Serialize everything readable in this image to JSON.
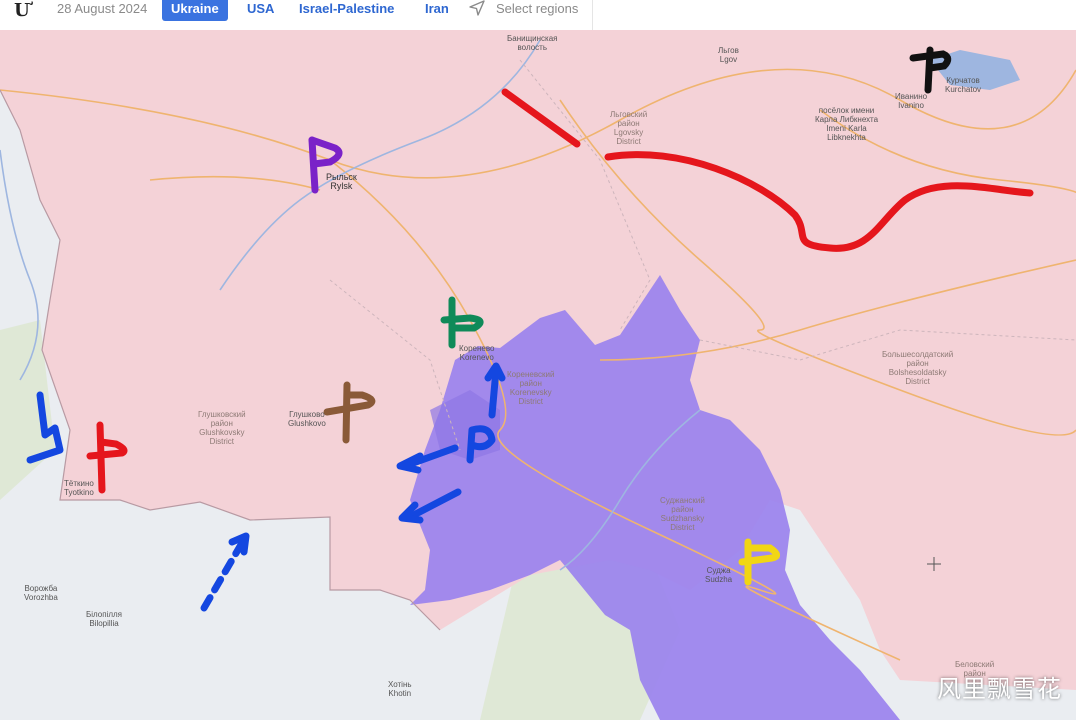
{
  "toolbar": {
    "logo": "Ư",
    "date": "28 August 2024",
    "tabs": [
      {
        "label": "Ukraine",
        "active": true
      },
      {
        "label": "USA",
        "active": false
      },
      {
        "label": "Israel-Palestine",
        "active": false
      },
      {
        "label": "Iran",
        "active": false
      }
    ],
    "select_regions": "Select regions",
    "select_icon": "navigation-arrow-icon"
  },
  "map": {
    "colors": {
      "russia_territory": "#f4d2d7",
      "occupied_zone": "#9a82ee",
      "ukraine_territory": "#eaedf1",
      "roads": "#efb46f",
      "annotation_red": "#e5161c",
      "annotation_blue": "#1447e0"
    },
    "labels": {
      "bachinskaya": [
        "Банищинская",
        "волость"
      ],
      "lgov": [
        "Льгов",
        "Lgov"
      ],
      "kurchatov": [
        "Курчатов",
        "Kurchatov"
      ],
      "ivanino": [
        "Иванино",
        "Ivanino"
      ],
      "imeni_karla": [
        "посёлок имени",
        "Карла Либкнехта",
        "Imeni Karla",
        "Libknekhta"
      ],
      "lgovsky_district": [
        "Льговский",
        "район",
        "Lgovsky",
        "District"
      ],
      "rylsk": [
        "Рыльск",
        "Rylsk"
      ],
      "korenevo": [
        "Коренево",
        "Korenevo"
      ],
      "korenevsky_district": [
        "Кореневский",
        "район",
        "Korenevsky",
        "District"
      ],
      "glushkovsky_district": [
        "Глушковский",
        "район",
        "Glushkovsky",
        "District"
      ],
      "glushkovo": [
        "Глушково",
        "Glushkovo"
      ],
      "tetkino": [
        "Тёткино",
        "Tyotkino"
      ],
      "vorozhba": [
        "Ворожба",
        "Vorozhba"
      ],
      "bilopillia": [
        "Білопілля",
        "Bilopillia"
      ],
      "sudzhansky_district": [
        "Суджанский",
        "район",
        "Sudzhansky",
        "District"
      ],
      "sudzha": [
        "Суджа",
        "Sudzha"
      ],
      "bolshesoldatsky_district": [
        "Большесолдатский",
        "район",
        "Bolshesoldatsky",
        "District"
      ],
      "belovsky": [
        "Беловский",
        "район"
      ],
      "khotin": [
        "Хотінь",
        "Khotin"
      ]
    },
    "watermark": "风里飘雪花"
  }
}
